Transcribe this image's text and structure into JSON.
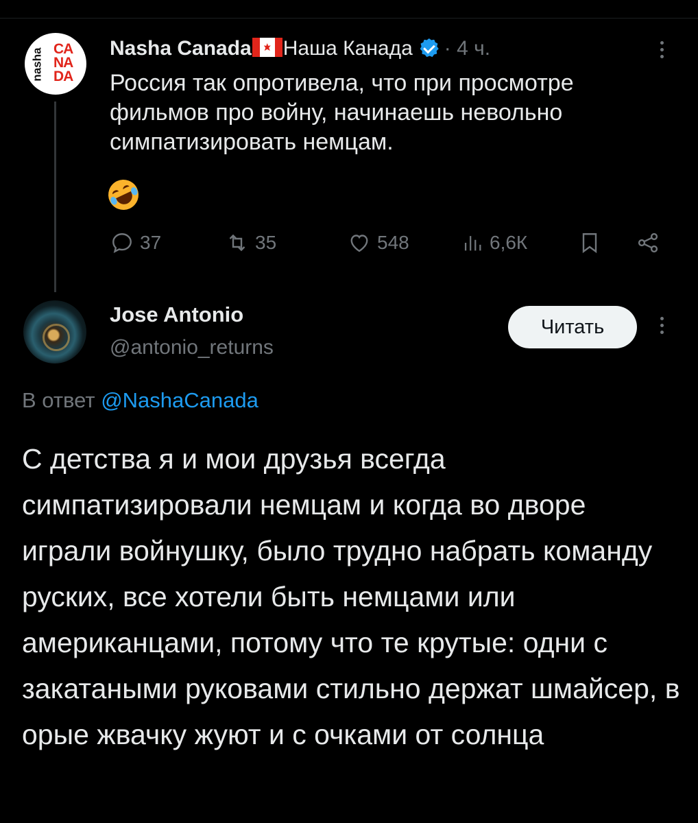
{
  "tweet1": {
    "display_name_latin": "Nasha Canada",
    "display_name_cyr": "Наша Канада",
    "time": "· 4 ч.",
    "avatar_text": {
      "line1": "CA",
      "line2": "NA",
      "line3": "DA",
      "side": "nasha"
    },
    "text": "Россия так опротивела, что при просмотре фильмов про войну, начинаешь невольно симпатизировать немцам.",
    "emoji": "rolling-on-floor-laughing",
    "actions": {
      "replies": "37",
      "reposts": "35",
      "likes": "548",
      "views": "6,6К"
    }
  },
  "tweet2": {
    "display_name": "Jose Antonio",
    "handle": "@antonio_returns",
    "follow_label": "Читать",
    "reply_prefix": "В ответ",
    "reply_to": "@NashaCanada",
    "text": "С детства я и мои друзья всегда симпатизировали немцам и когда во дворе играли войнушку, было трудно набрать команду руских, все хотели быть немцами или американцами, потому что те крутые: одни с закатаными руковами стильно держат шмайсер, в орые жвачку жуют и с очками от солнца"
  },
  "colors": {
    "background": "#000000",
    "text": "#e7e9ea",
    "muted": "#71767b",
    "accent": "#1d9bf0",
    "brand_red": "#e1251b"
  }
}
